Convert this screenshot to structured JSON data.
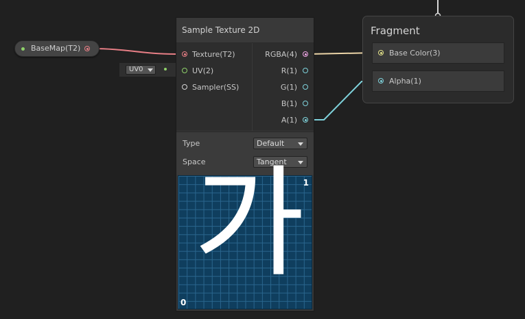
{
  "property_node": {
    "label": "BaseMap(T2)",
    "port_color": "#e87f86",
    "dot_color": "#8fd16a"
  },
  "uv_input": {
    "value": "UV0",
    "dot_color": "#8fd16a"
  },
  "sample_texture": {
    "title": "Sample Texture 2D",
    "inputs": [
      {
        "label": "Texture(T2)",
        "color": "#e87f86"
      },
      {
        "label": "UV(2)",
        "color": "#8fd16a"
      },
      {
        "label": "Sampler(SS)",
        "color": "#d8d8d8"
      }
    ],
    "outputs": [
      {
        "label": "RGBA(4)",
        "color": "#f0a6e6"
      },
      {
        "label": "R(1)",
        "color": "#7fd3dc"
      },
      {
        "label": "G(1)",
        "color": "#7fd3dc"
      },
      {
        "label": "B(1)",
        "color": "#7fd3dc"
      },
      {
        "label": "A(1)",
        "color": "#7fd3dc"
      }
    ],
    "properties": [
      {
        "label": "Type",
        "value": "Default"
      },
      {
        "label": "Space",
        "value": "Tangent"
      }
    ],
    "preview": {
      "glyph": "가",
      "corner_top_right": "1",
      "corner_bottom_left": "0"
    }
  },
  "fragment": {
    "title": "Fragment",
    "slots": [
      {
        "label": "Base Color(3)",
        "color": "#e6e48a"
      },
      {
        "label": "Alpha(1)",
        "color": "#7fd3dc"
      }
    ]
  }
}
